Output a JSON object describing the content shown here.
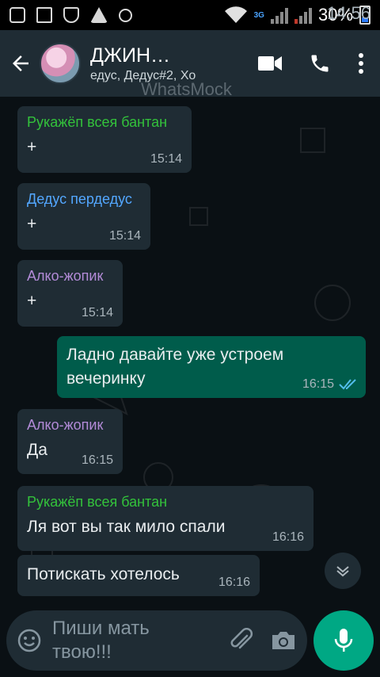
{
  "status_bar": {
    "network": "3G",
    "battery": "30%",
    "time": "14:56"
  },
  "header": {
    "title": "ДЖИН…",
    "subtitle": "едус, Дедус#2, Хо",
    "watermark": "WhatsMock"
  },
  "messages": [
    {
      "sender": "Рукажёп всея бантан",
      "sender_color": "#33c23b",
      "text": "+",
      "time": "15:14",
      "direction": "in"
    },
    {
      "sender": "Дедус пердедус",
      "sender_color": "#53a7ff",
      "text": "+",
      "time": "15:14",
      "direction": "in"
    },
    {
      "sender": "Алко-жопик",
      "sender_color": "#b38bd8",
      "text": "+",
      "time": "15:14",
      "direction": "in"
    },
    {
      "sender": "",
      "text": "Ладно давайте уже устроем вечеринку",
      "time": "16:15",
      "direction": "out",
      "status": "read"
    },
    {
      "sender": "Алко-жопик",
      "sender_color": "#b38bd8",
      "text": "Да",
      "time": "16:15",
      "direction": "in"
    },
    {
      "sender": "Рукажёп всея бантан",
      "sender_color": "#33c23b",
      "text": "Ля вот вы так мило спали",
      "time": "16:16",
      "direction": "in"
    },
    {
      "sender": "",
      "text": "Потискать хотелось",
      "time": "16:16",
      "direction": "in"
    }
  ],
  "input": {
    "placeholder": "Пиши мать твою!!!"
  },
  "colors": {
    "header_bg": "#1f2c34",
    "in_bubble": "#1f2c34",
    "out_bubble": "#005c4b",
    "accent": "#00a884",
    "read_tick": "#53bdeb"
  },
  "icons": [
    "back-arrow-icon",
    "video-call-icon",
    "phone-icon",
    "more-vert-icon",
    "scroll-down-icon",
    "emoji-icon",
    "attach-icon",
    "camera-icon",
    "mic-icon"
  ]
}
